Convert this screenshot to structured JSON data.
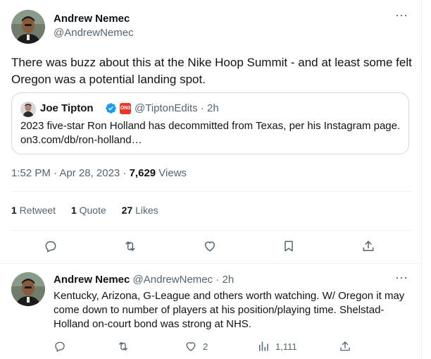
{
  "main_tweet": {
    "author_name": "Andrew Nemec",
    "author_handle": "@AndrewNemec",
    "more_label": "···",
    "text": "There was buzz about this at the Nike Hoop Summit - and at least some felt Oregon was a potential landing spot.",
    "quote": {
      "author_name": "Joe Tipton",
      "badge_text": "ON3",
      "author_handle_time": "@TiptonEdits · 2h",
      "text": "2023 five-star Ron Holland has decommitted from Texas, per his Instagram page.  on3.com/db/ron-holland…"
    },
    "timestamp": "1:52 PM · Apr 28, 2023 · ",
    "views_count": "7,629",
    "views_label": " Views",
    "stats": {
      "retweets_count": "1",
      "retweets_label": " Retweet",
      "quotes_count": "1",
      "quotes_label": " Quote",
      "likes_count": "27",
      "likes_label": " Likes"
    },
    "actions": [
      "reply-icon",
      "retweet-icon",
      "like-icon",
      "bookmark-icon",
      "share-icon"
    ]
  },
  "reply_tweet": {
    "author_name": "Andrew Nemec",
    "author_handle_time": " @AndrewNemec · 2h",
    "more_label": "···",
    "text": "Kentucky, Arizona, G-League and others worth watching. W/ Oregon it may come down to number of players at his position/playing time. Shelstad-Holland on-court bond was strong at NHS.",
    "likes_count": "2",
    "views_count": "1,111"
  },
  "colors": {
    "text": "#0f1419",
    "secondary": "#536471",
    "border": "#cfd9de",
    "verified": "#1d9bf0",
    "badge": "#e8382d"
  }
}
